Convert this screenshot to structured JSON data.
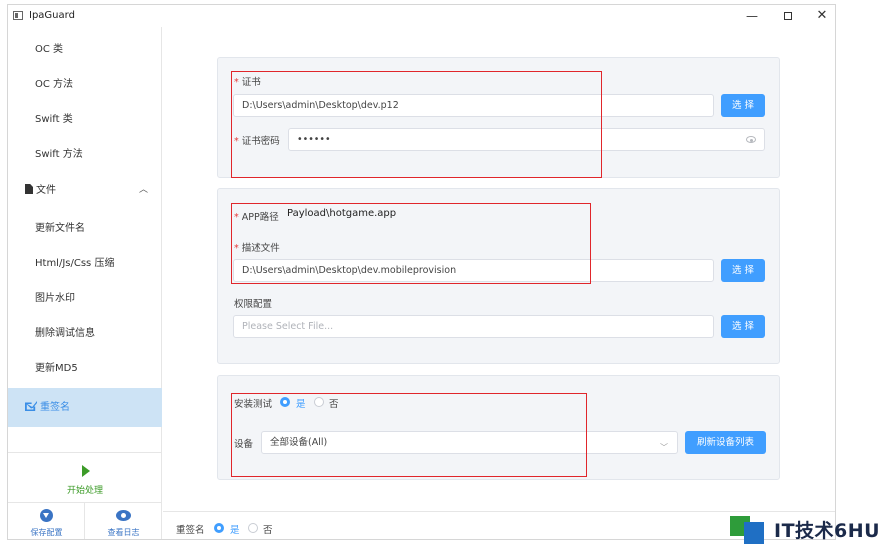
{
  "window": {
    "title": "IpaGuard",
    "min_glyph": "—",
    "close_glyph": "✕"
  },
  "sidebar": {
    "items": [
      {
        "label": "OC 类"
      },
      {
        "label": "OC 方法"
      },
      {
        "label": "Swift 类"
      },
      {
        "label": "Swift 方法"
      },
      {
        "label": "文件",
        "chevron": "︿"
      },
      {
        "label": "更新文件名"
      },
      {
        "label": "Html/Js/Css 压缩"
      },
      {
        "label": "图片水印"
      },
      {
        "label": "删除调试信息"
      },
      {
        "label": "更新MD5"
      },
      {
        "label": "重签名"
      }
    ],
    "start_label": "开始处理",
    "save_label": "保存配置",
    "log_label": "查看日志"
  },
  "cert": {
    "required_mark": "*",
    "cert_label": "证书",
    "cert_value": "D:\\Users\\admin\\Desktop\\dev.p12",
    "choose_label": "选 择",
    "password_label": "证书密码",
    "password_value": "••••••"
  },
  "app": {
    "path_label": "APP路径",
    "path_value": "Payload\\hotgame.app",
    "profile_label": "描述文件",
    "profile_value": "D:\\Users\\admin\\Desktop\\dev.mobileprovision",
    "choose_label": "选 择",
    "entitlements_label": "权限配置",
    "entitlements_placeholder": "Please Select File...",
    "choose_label_2": "选 择"
  },
  "install": {
    "test_label": "安装测试",
    "yes_label": "是",
    "no_label": "否",
    "device_label": "设备",
    "device_value": "全部设备(All)",
    "refresh_label": "刷新设备列表",
    "selected": "yes"
  },
  "footer": {
    "resign_label": "重签名",
    "yes_label": "是",
    "no_label": "否",
    "selected": "yes"
  },
  "watermark": {
    "text": "IT技术6HU"
  },
  "colors": {
    "accent": "#409eff",
    "active_bg": "#cde3f5",
    "start_green": "#3c9b28",
    "highlight_red": "#e0262b"
  }
}
